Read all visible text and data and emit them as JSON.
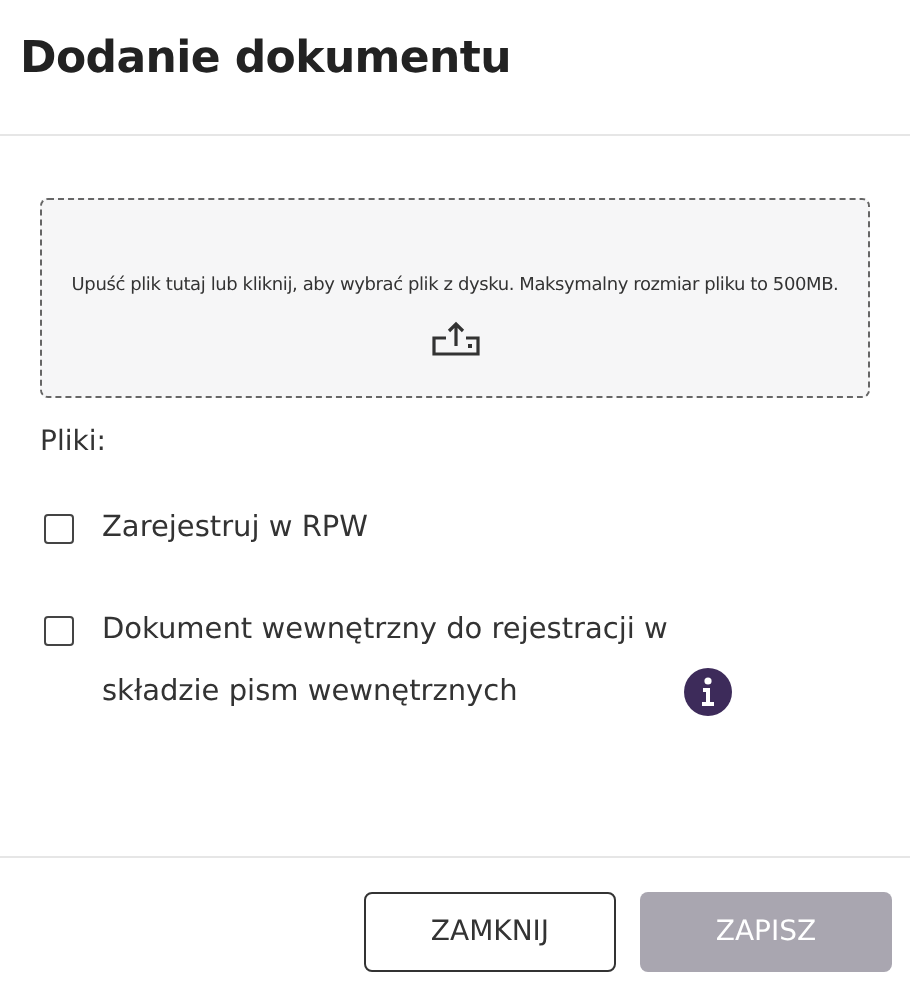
{
  "dialog": {
    "title": "Dodanie dokumentu"
  },
  "dropzone": {
    "text": "Upuść plik tutaj lub kliknij, aby wybrać plik z dysku. Maksymalny rozmiar pliku to 500MB."
  },
  "files_label": "Pliki:",
  "options": [
    {
      "label": "Zarejestruj w RPW",
      "checked": false,
      "info": false
    },
    {
      "label": "Dokument wewnętrzny do rejestracji w składzie pism wewnętrznych",
      "checked": false,
      "info": true
    }
  ],
  "buttons": [
    {
      "label": "ZAMKNIJ",
      "kind": "outline",
      "disabled": false
    },
    {
      "label": "ZAPISZ",
      "kind": "primary",
      "disabled": true
    }
  ]
}
